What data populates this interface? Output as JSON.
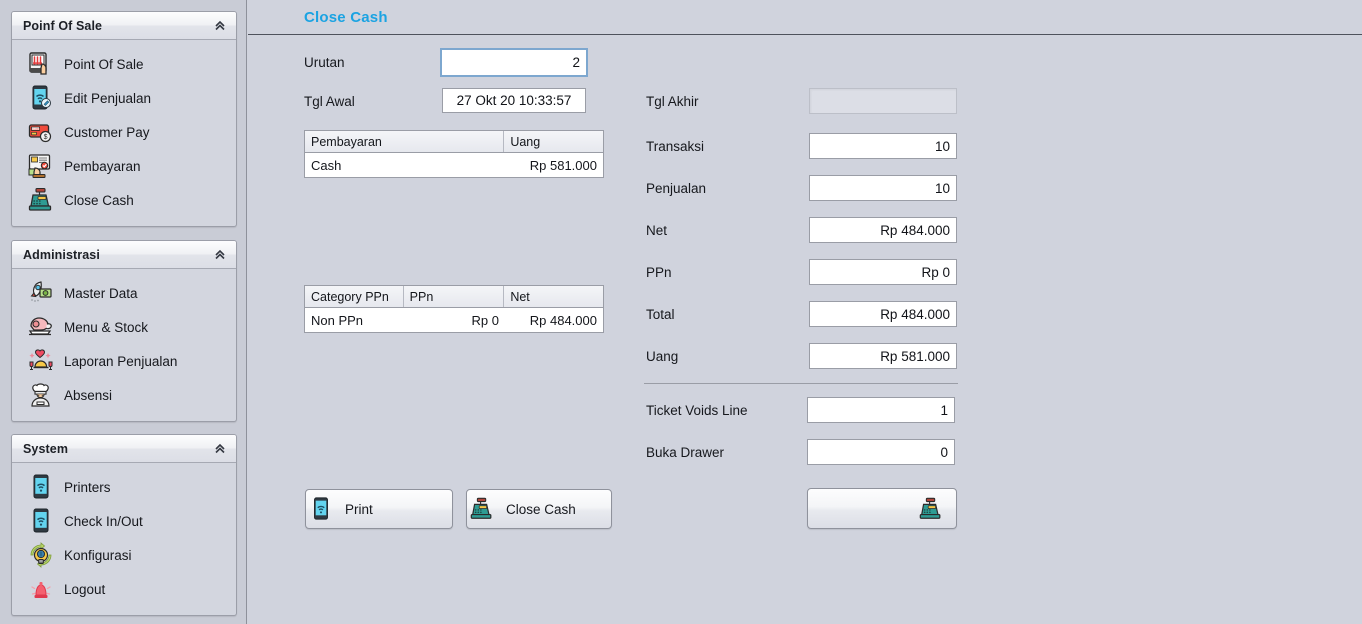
{
  "window": {
    "background_color": "#d0d3dd",
    "accent_color": "#1ba3e2"
  },
  "sidebar": {
    "panels": [
      {
        "title": "Poinf Of Sale",
        "collapse_icon": "chevron-double-up-icon",
        "items": [
          {
            "label": "Point Of Sale",
            "icon": "pos-terminal-icon"
          },
          {
            "label": "Edit Penjualan",
            "icon": "mobile-wifi-edit-icon"
          },
          {
            "label": "Customer Pay",
            "icon": "credit-card-icon"
          },
          {
            "label": "Pembayaran",
            "icon": "payment-terminal-icon"
          },
          {
            "label": "Close Cash",
            "icon": "cash-register-icon"
          }
        ]
      },
      {
        "title": "Administrasi",
        "collapse_icon": "chevron-double-up-icon",
        "items": [
          {
            "label": "Master Data",
            "icon": "rocket-data-icon"
          },
          {
            "label": "Menu & Stock",
            "icon": "ham-meat-icon"
          },
          {
            "label": "Laporan Penjualan",
            "icon": "dinner-report-icon"
          },
          {
            "label": "Absensi",
            "icon": "chef-icon"
          }
        ]
      },
      {
        "title": "System",
        "collapse_icon": "chevron-double-up-icon",
        "items": [
          {
            "label": "Printers",
            "icon": "mobile-wifi-icon"
          },
          {
            "label": "Check In/Out",
            "icon": "mobile-wifi-icon"
          },
          {
            "label": "Konfigurasi",
            "icon": "gear-bulb-icon"
          },
          {
            "label": "Logout",
            "icon": "alarm-siren-icon"
          }
        ]
      }
    ]
  },
  "splitter": {
    "name": "collapse-sidebar-handle",
    "icon": "arrow-left-icon",
    "color": "#3fb9bf"
  },
  "main": {
    "page_title": "Close Cash",
    "left_form": {
      "urutan": {
        "label": "Urutan",
        "value": "2",
        "focused": true
      },
      "tgl_awal": {
        "label": "Tgl Awal",
        "value": "27 Okt 20 10:33:57"
      }
    },
    "payment_table": {
      "columns": [
        "Pembayaran",
        "Uang"
      ],
      "rows": [
        {
          "pembayaran": "Cash",
          "uang": "Rp 581.000"
        }
      ]
    },
    "ppn_table": {
      "columns": [
        "Category PPn",
        "PPn",
        "Net"
      ],
      "rows": [
        {
          "category": "Non PPn",
          "ppn": "Rp 0",
          "net": "Rp 484.000"
        }
      ]
    },
    "right_form": {
      "fields": [
        {
          "label": "Tgl Akhir",
          "value": "",
          "disabled": true
        },
        {
          "label": "Transaksi",
          "value": "10",
          "disabled": false
        },
        {
          "label": "Penjualan",
          "value": "10",
          "disabled": false
        },
        {
          "label": "Net",
          "value": "Rp 484.000",
          "disabled": false
        },
        {
          "label": "PPn",
          "value": "Rp 0",
          "disabled": false
        },
        {
          "label": "Total",
          "value": "Rp 484.000",
          "disabled": false
        },
        {
          "label": "Uang",
          "value": "Rp 581.000",
          "disabled": false
        }
      ],
      "extra_fields": [
        {
          "label": "Ticket Voids Line",
          "value": "1"
        },
        {
          "label": "Buka Drawer",
          "value": "0"
        }
      ]
    },
    "buttons": {
      "print": {
        "label": "Print",
        "icon": "mobile-wifi-icon"
      },
      "close_cash": {
        "label": "Close Cash",
        "icon": "cash-register-icon"
      },
      "open_drawer": {
        "label": "",
        "icon": "cash-register-icon"
      }
    }
  }
}
